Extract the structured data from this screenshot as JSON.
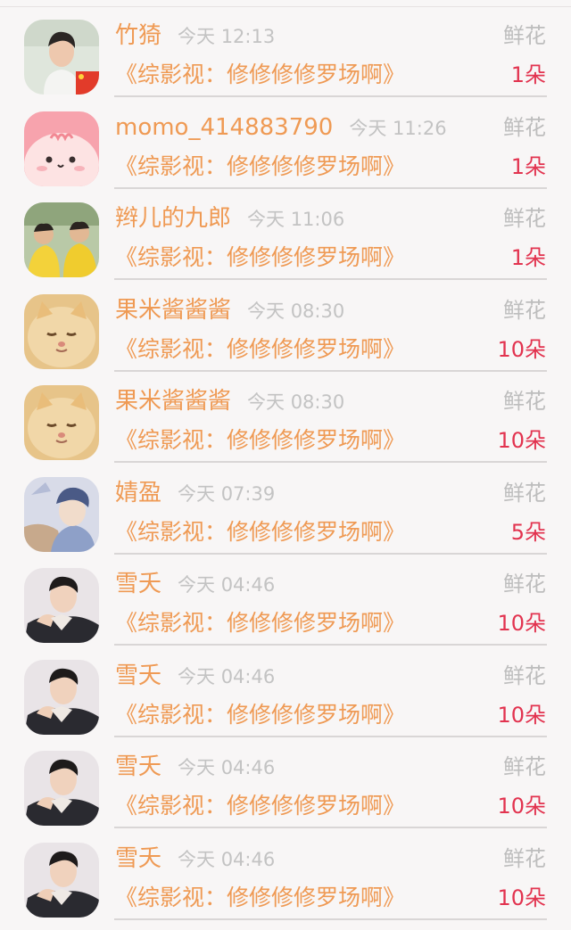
{
  "colors": {
    "name": "#ef9a54",
    "time": "#c3c3c3",
    "gift_label": "#bdbdbd",
    "count": "#e2334f",
    "background": "#f8f6f6"
  },
  "items": [
    {
      "name": "竹猗",
      "time": "今天 12:13",
      "gift": "鲜花",
      "title": "《综影视：修修修修罗场啊》",
      "count": "1朵",
      "avatar": "avatar-man-flag"
    },
    {
      "name": "momo_414883790",
      "time": "今天 11:26",
      "gift": "鲜花",
      "title": "《综影视：修修修修罗场啊》",
      "count": "1朵",
      "avatar": "avatar-pink-cartoon"
    },
    {
      "name": "辫儿的九郎",
      "time": "今天 11:06",
      "gift": "鲜花",
      "title": "《综影视：修修修修罗场啊》",
      "count": "1朵",
      "avatar": "avatar-yellow-duo"
    },
    {
      "name": "果米酱酱酱",
      "time": "今天 08:30",
      "gift": "鲜花",
      "title": "《综影视：修修修修罗场啊》",
      "count": "10朵",
      "avatar": "avatar-kitten"
    },
    {
      "name": "果米酱酱酱",
      "time": "今天 08:30",
      "gift": "鲜花",
      "title": "《综影视：修修修修罗场啊》",
      "count": "10朵",
      "avatar": "avatar-kitten"
    },
    {
      "name": "婧盈",
      "time": "今天 07:39",
      "gift": "鲜花",
      "title": "《综影视：修修修修罗场啊》",
      "count": "5朵",
      "avatar": "avatar-anime-boy"
    },
    {
      "name": "雪夭",
      "time": "今天 04:46",
      "gift": "鲜花",
      "title": "《综影视：修修修修罗场啊》",
      "count": "10朵",
      "avatar": "avatar-man-suit"
    },
    {
      "name": "雪夭",
      "time": "今天 04:46",
      "gift": "鲜花",
      "title": "《综影视：修修修修罗场啊》",
      "count": "10朵",
      "avatar": "avatar-man-suit"
    },
    {
      "name": "雪夭",
      "time": "今天 04:46",
      "gift": "鲜花",
      "title": "《综影视：修修修修罗场啊》",
      "count": "10朵",
      "avatar": "avatar-man-suit"
    },
    {
      "name": "雪夭",
      "time": "今天 04:46",
      "gift": "鲜花",
      "title": "《综影视：修修修修罗场啊》",
      "count": "10朵",
      "avatar": "avatar-man-suit"
    }
  ]
}
